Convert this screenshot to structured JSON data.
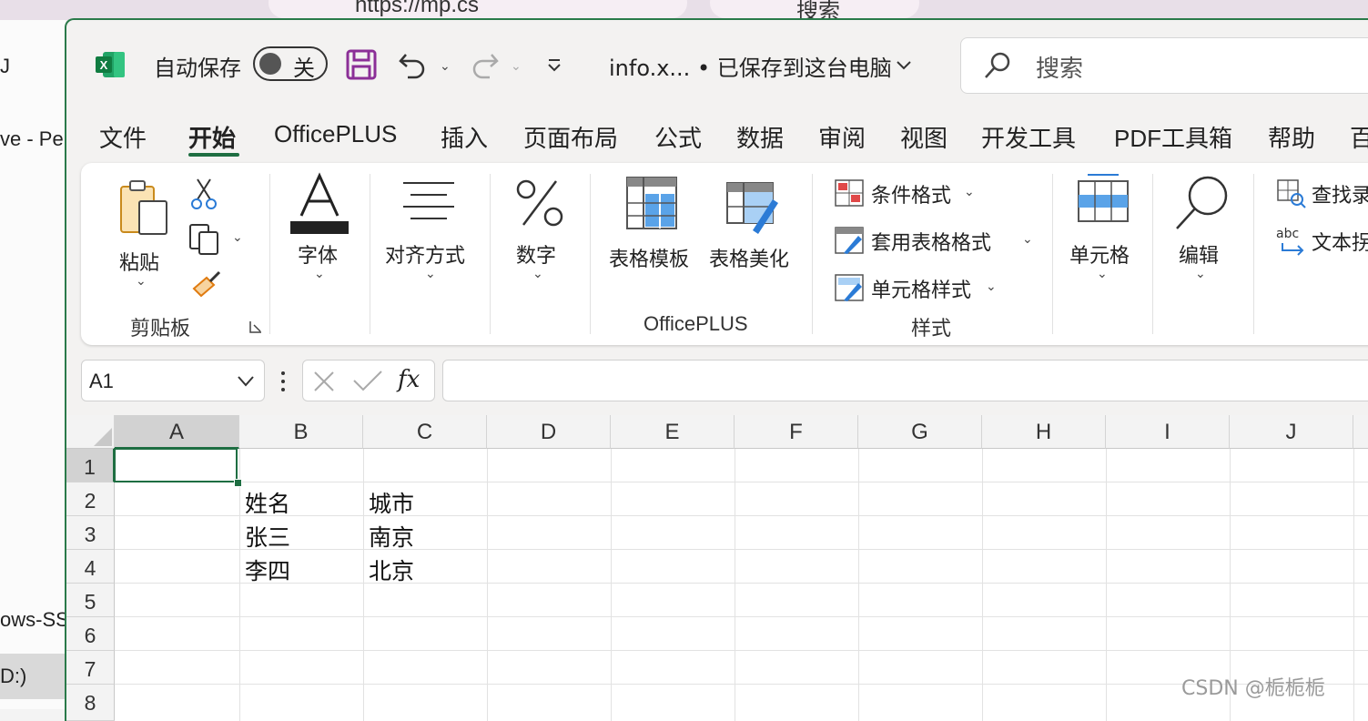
{
  "background": {
    "browser_url": "https://mp.cs",
    "browser_search": "搜索",
    "left_texts": [
      "J",
      "ve - Pe",
      "ows-SS",
      "D:)"
    ]
  },
  "titlebar": {
    "autosave_label": "自动保存",
    "autosave_state": "关",
    "doc_title": "info.x... • 已保存到这台电脑",
    "search_placeholder": "搜索"
  },
  "tabs": [
    "文件",
    "开始",
    "OfficePLUS",
    "插入",
    "页面布局",
    "公式",
    "数据",
    "审阅",
    "视图",
    "开发工具",
    "PDF工具箱",
    "帮助",
    "百"
  ],
  "active_tab": "开始",
  "ribbon": {
    "paste": "粘贴",
    "clipboard_group": "剪贴板",
    "font": "字体",
    "align": "对齐方式",
    "number": "数字",
    "table_template": "表格模板",
    "table_beautify": "表格美化",
    "officeplus_group": "OfficePLUS",
    "cond_format": "条件格式",
    "table_format": "套用表格格式",
    "cell_style": "单元格样式",
    "styles_group": "样式",
    "cells": "单元格",
    "edit": "编辑",
    "find": "查找录",
    "text": "文本拐"
  },
  "formula_bar": {
    "name_box": "A1",
    "fx": "fx",
    "formula": ""
  },
  "sheet": {
    "columns": [
      "A",
      "B",
      "C",
      "D",
      "E",
      "F",
      "G",
      "H",
      "I",
      "J"
    ],
    "rows": [
      "1",
      "2",
      "3",
      "4",
      "5",
      "6",
      "7",
      "8"
    ],
    "cells": {
      "B2": "姓名",
      "C2": "城市",
      "B3": "张三",
      "C3": "南京",
      "B4": "李四",
      "C4": "北京"
    },
    "selected": "A1"
  },
  "watermark": "CSDN @栀栀栀",
  "colors": {
    "excel_green": "#1e6e42",
    "accent_purple": "#8b2f97"
  }
}
